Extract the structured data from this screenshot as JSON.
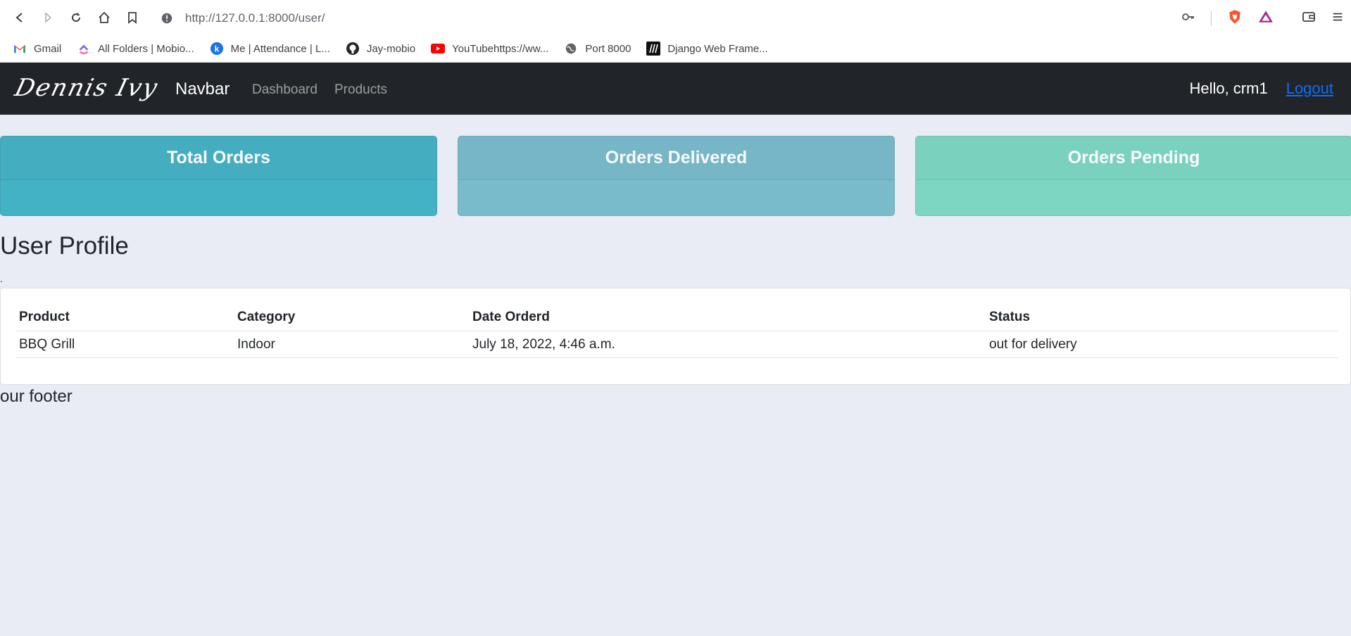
{
  "browser": {
    "url": "http://127.0.0.1:8000/user/",
    "bookmarks": [
      {
        "label": "Gmail",
        "icon": "gmail-icon"
      },
      {
        "label": "All Folders | Mobio...",
        "icon": "clickup-icon"
      },
      {
        "label": "Me | Attendance | L...",
        "icon": "k-icon"
      },
      {
        "label": "Jay-mobio",
        "icon": "github-icon"
      },
      {
        "label": "YouTubehttps://ww...",
        "icon": "youtube-icon"
      },
      {
        "label": "Port 8000",
        "icon": "globe-icon"
      },
      {
        "label": "Django Web Frame...",
        "icon": "django-icon"
      }
    ]
  },
  "navbar": {
    "logo": "Dennis Ivy",
    "brand": "Navbar",
    "links": [
      "Dashboard",
      "Products"
    ],
    "greeting": "Hello, crm1",
    "logout": "Logout"
  },
  "cards": [
    {
      "title": "Total Orders",
      "color": "#17a2b8"
    },
    {
      "title": "Orders Delivered",
      "color": "#5aaec0"
    },
    {
      "title": "Orders Pending",
      "color": "#5fd1b4"
    }
  ],
  "page": {
    "heading": "User Profile",
    "dot": ".",
    "footer": "our footer"
  },
  "table": {
    "headers": [
      "Product",
      "Category",
      "Date Orderd",
      "Status"
    ],
    "rows": [
      [
        "BBQ Grill",
        "Indoor",
        "July 18, 2022, 4:46 a.m.",
        "out for delivery"
      ]
    ]
  }
}
